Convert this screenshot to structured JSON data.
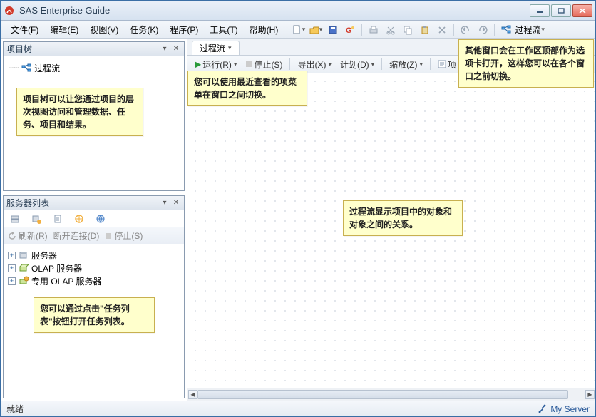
{
  "window": {
    "title": "SAS Enterprise Guide"
  },
  "menu": {
    "file": "文件(F)",
    "edit": "编辑(E)",
    "view": "视图(V)",
    "tasks": "任务(K)",
    "program": "程序(P)",
    "tools": "工具(T)",
    "help": "帮助(H)",
    "processFlowBtn": "过程流"
  },
  "projectTree": {
    "title": "项目树",
    "rootLabel": "过程流"
  },
  "serverList": {
    "title": "服务器列表",
    "refresh": "刷新(R)",
    "disconnect": "断开连接(D)",
    "stop": "停止(S)",
    "nodes": {
      "servers": "服务器",
      "olap": "OLAP 服务器",
      "dedicatedOlap": "专用 OLAP 服务器"
    }
  },
  "flow": {
    "tabLabel": "过程流",
    "toolbar": {
      "run": "运行(R)",
      "stop": "停止(S)",
      "export": "导出(X)",
      "schedule": "计划(D)",
      "zoom": "缩放(Z)",
      "project": "项"
    }
  },
  "callouts": {
    "projectTree": "项目树可以让您通过项目的层次视图访问和管理数据、任务、项目和结果。",
    "recentViews": "您可以使用最近查看的项菜单在窗口之间切换。",
    "flowCenter": "过程流显示项目中的对象和对象之间的关系。",
    "otherWindows": "其他窗口会在工作区顶部作为选项卡打开，这样您可以在各个窗口之前切换。",
    "taskList": "您可以通过点击\"任务列表\"按钮打开任务列表。"
  },
  "status": {
    "ready": "就绪",
    "server": "My Server"
  }
}
